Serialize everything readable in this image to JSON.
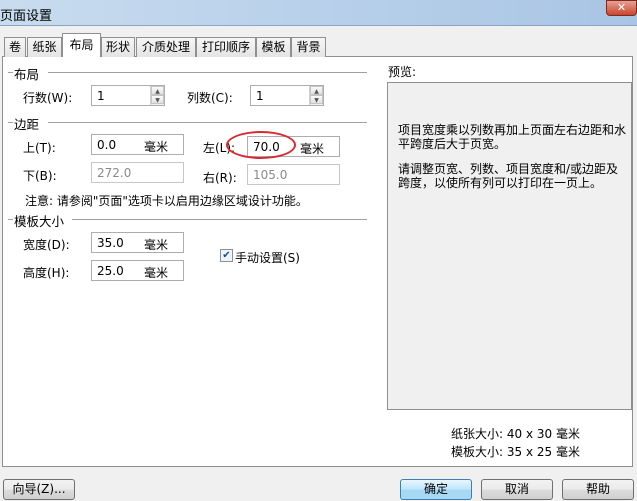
{
  "window": {
    "title": "页面设置",
    "close": "✕"
  },
  "tabs": [
    {
      "label": "卷"
    },
    {
      "label": "纸张"
    },
    {
      "label": "布局"
    },
    {
      "label": "形状"
    },
    {
      "label": "介质处理"
    },
    {
      "label": "打印顺序"
    },
    {
      "label": "模板"
    },
    {
      "label": "背景"
    }
  ],
  "active_tab": "布局",
  "layout": {
    "group": "布局",
    "rows_label": "行数(W):",
    "rows_value": "1",
    "cols_label": "列数(C):",
    "cols_value": "1"
  },
  "margins": {
    "group": "边距",
    "top_label": "上(T):",
    "top_value": "0.0",
    "left_label": "左(L):",
    "left_value": "70.0",
    "bottom_label": "下(B):",
    "bottom_value": "272.0",
    "right_label": "右(R):",
    "right_value": "105.0",
    "unit": "毫米",
    "note": "注意: 请参阅\"页面\"选项卡以启用边缘区域设计功能。"
  },
  "template_size": {
    "group": "模板大小",
    "width_label": "宽度(D):",
    "width_value": "35.0",
    "height_label": "高度(H):",
    "height_value": "25.0",
    "unit": "毫米",
    "manual_label": "手动设置(S)",
    "manual_checked": true,
    "check": "✔"
  },
  "preview": {
    "label": "预览:",
    "message1": "项目宽度乘以列数再加上页面左右边距和水平跨度后大于页宽。",
    "message2": "请调整页宽、列数、项目宽度和/或边距及跨度，以使所有列可以打印在一页上。",
    "paper_size": "纸张大小: 40 x 30 毫米",
    "template_size": "模板大小: 35 x 25 毫米"
  },
  "buttons": {
    "wizard": "向导(Z)...",
    "ok": "确定",
    "cancel": "取消",
    "help": "帮助"
  },
  "spin": {
    "up": "▲",
    "down": "▼"
  },
  "colors": {
    "highlight_ellipse": "#d9292f",
    "default_button": "#3c7fb1"
  }
}
